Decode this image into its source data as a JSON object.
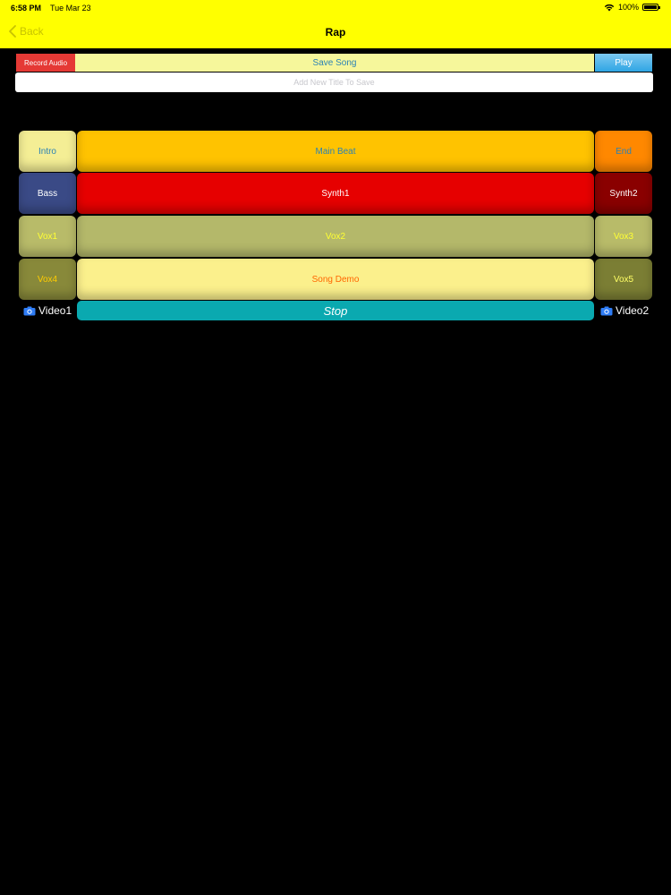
{
  "status_bar": {
    "time": "6:58 PM",
    "date": "Tue Mar 23",
    "battery": "100%",
    "icons": [
      "wifi-icon",
      "battery-icon"
    ]
  },
  "nav": {
    "back_label": "Back",
    "title": "Rap"
  },
  "toolbar": {
    "record_label": "Record Audio",
    "save_label": "Save Song",
    "play_label": "Play"
  },
  "title_input": {
    "value": "",
    "placeholder": "Add New Title To Save"
  },
  "pads": {
    "intro": {
      "label": "Intro",
      "bg": "#f4ee95",
      "fg": "#2a82b5"
    },
    "main_beat": {
      "label": "Main Beat",
      "bg": "#ffc300",
      "fg": "#2a82b5"
    },
    "end": {
      "label": "End",
      "bg": "#ff8800",
      "fg": "#2a82b5"
    },
    "bass": {
      "label": "Bass",
      "bg": "#3a4a86",
      "fg": "#ffffff"
    },
    "synth1": {
      "label": "Synth1",
      "bg": "#e60000",
      "fg": "#ffffff"
    },
    "synth2": {
      "label": "Synth2",
      "bg": "#8a0000",
      "fg": "#ffffff"
    },
    "vox1": {
      "label": "Vox1",
      "bg": "#b8bb69",
      "fg": "#ffff33"
    },
    "vox2": {
      "label": "Vox2",
      "bg": "#b4b86a",
      "fg": "#ffff33"
    },
    "vox3": {
      "label": "Vox3",
      "bg": "#b8bb69",
      "fg": "#ffff33"
    },
    "vox4": {
      "label": "Vox4",
      "bg": "#88893a",
      "fg": "#ffcc00"
    },
    "song_demo": {
      "label": "Song Demo",
      "bg": "#fbf08c",
      "fg": "#ff6600"
    },
    "vox5": {
      "label": "Vox5",
      "bg": "#7b7e34",
      "fg": "#ffff66"
    }
  },
  "bottom": {
    "video1_label": "Video1",
    "stop_label": "Stop",
    "video2_label": "Video2"
  },
  "colors": {
    "nav_bg": "#ffff00",
    "accent_blue": "#2a82b5",
    "stop_bg": "#0aa9b0",
    "camera_icon": "#2f7df6"
  }
}
